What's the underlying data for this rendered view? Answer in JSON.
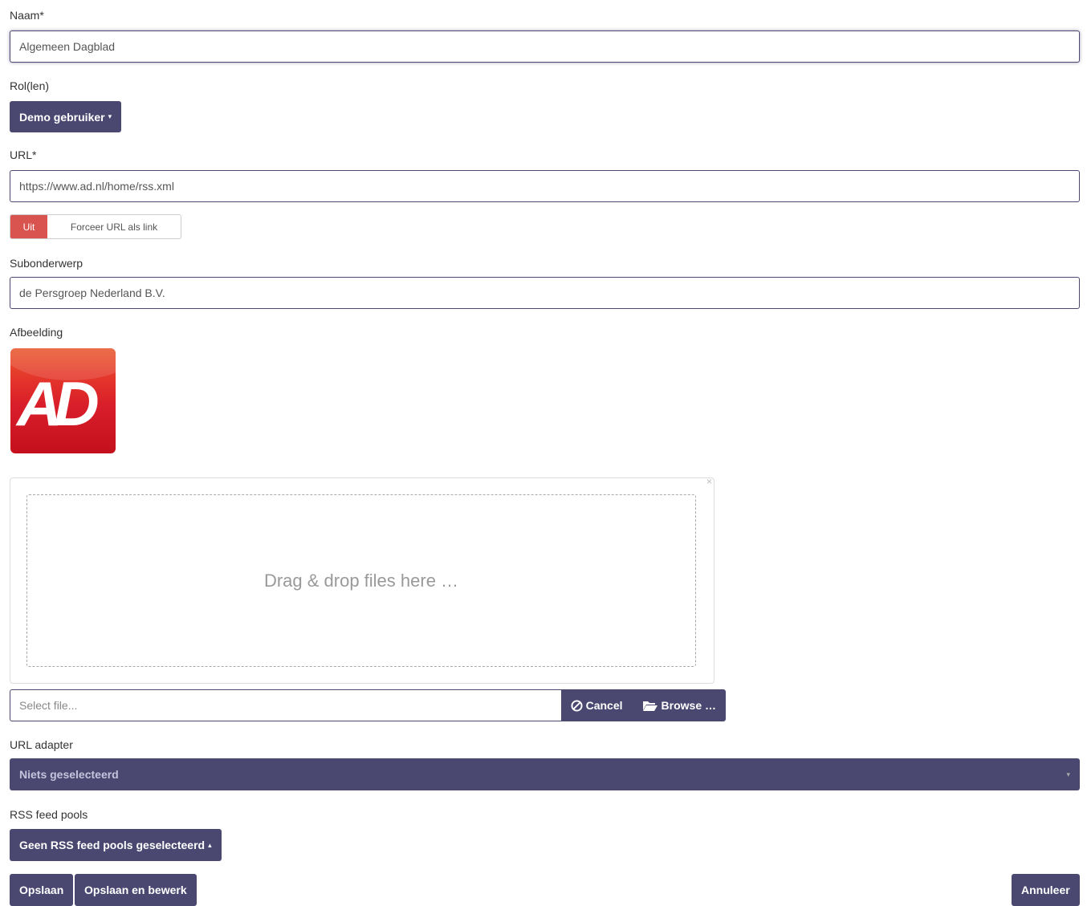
{
  "naam": {
    "label": "Naam*",
    "value": "Algemeen Dagblad"
  },
  "rollen": {
    "label": "Rol(len)",
    "button": "Demo gebruiker"
  },
  "url": {
    "label": "URL*",
    "value": "https://www.ad.nl/home/rss.xml"
  },
  "force_url": {
    "state": "Uit",
    "label": "Forceer URL als link"
  },
  "subonderwerp": {
    "label": "Subonderwerp",
    "value": "de Persgroep Nederland B.V."
  },
  "afbeelding": {
    "label": "Afbeelding",
    "logo_text": "AD"
  },
  "dropzone": {
    "text": "Drag & drop files here …",
    "close": "×"
  },
  "file_input": {
    "placeholder": "Select file...",
    "cancel": "Cancel",
    "browse": "Browse …"
  },
  "url_adapter": {
    "label": "URL adapter",
    "selected": "Niets geselecteerd"
  },
  "rss_pools": {
    "label": "RSS feed pools",
    "button": "Geen RSS feed pools geselecteerd"
  },
  "actions": {
    "save": "Opslaan",
    "save_edit": "Opslaan en bewerk",
    "cancel": "Annuleer"
  },
  "colors": {
    "primary": "#4a4770",
    "danger": "#d9534f",
    "logo_red": "#d81e2a"
  },
  "icons": {
    "cancel": "ban-icon",
    "browse": "folder-open-icon"
  }
}
